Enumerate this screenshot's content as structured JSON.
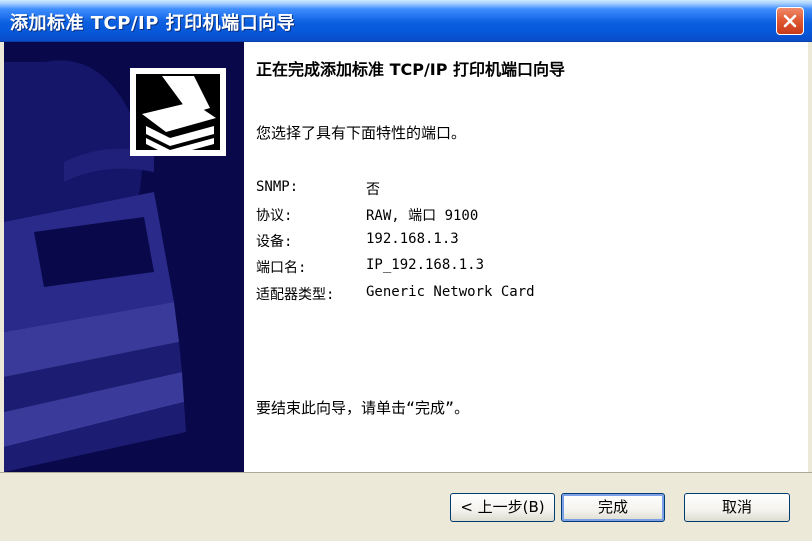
{
  "window": {
    "title": "添加标准 TCP/IP 打印机端口向导"
  },
  "content": {
    "heading": "正在完成添加标准 TCP/IP 打印机端口向导",
    "intro": "您选择了具有下面特性的端口。",
    "properties": [
      {
        "label": "SNMP:",
        "value": "否"
      },
      {
        "label": "协议:",
        "value": "RAW, 端口 9100"
      },
      {
        "label": "设备:",
        "value": "192.168.1.3"
      },
      {
        "label": "端口名:",
        "value": "IP_192.168.1.3"
      },
      {
        "label": "适配器类型:",
        "value": "Generic Network Card"
      }
    ],
    "finish_text": "要结束此向导，请单击“完成”。"
  },
  "buttons": {
    "back": "< 上一步(B)",
    "finish": "完成",
    "cancel": "取消"
  },
  "colors": {
    "titlebar": "#0a5fe0",
    "sidebar": "#08084a",
    "close": "#e05a35"
  }
}
